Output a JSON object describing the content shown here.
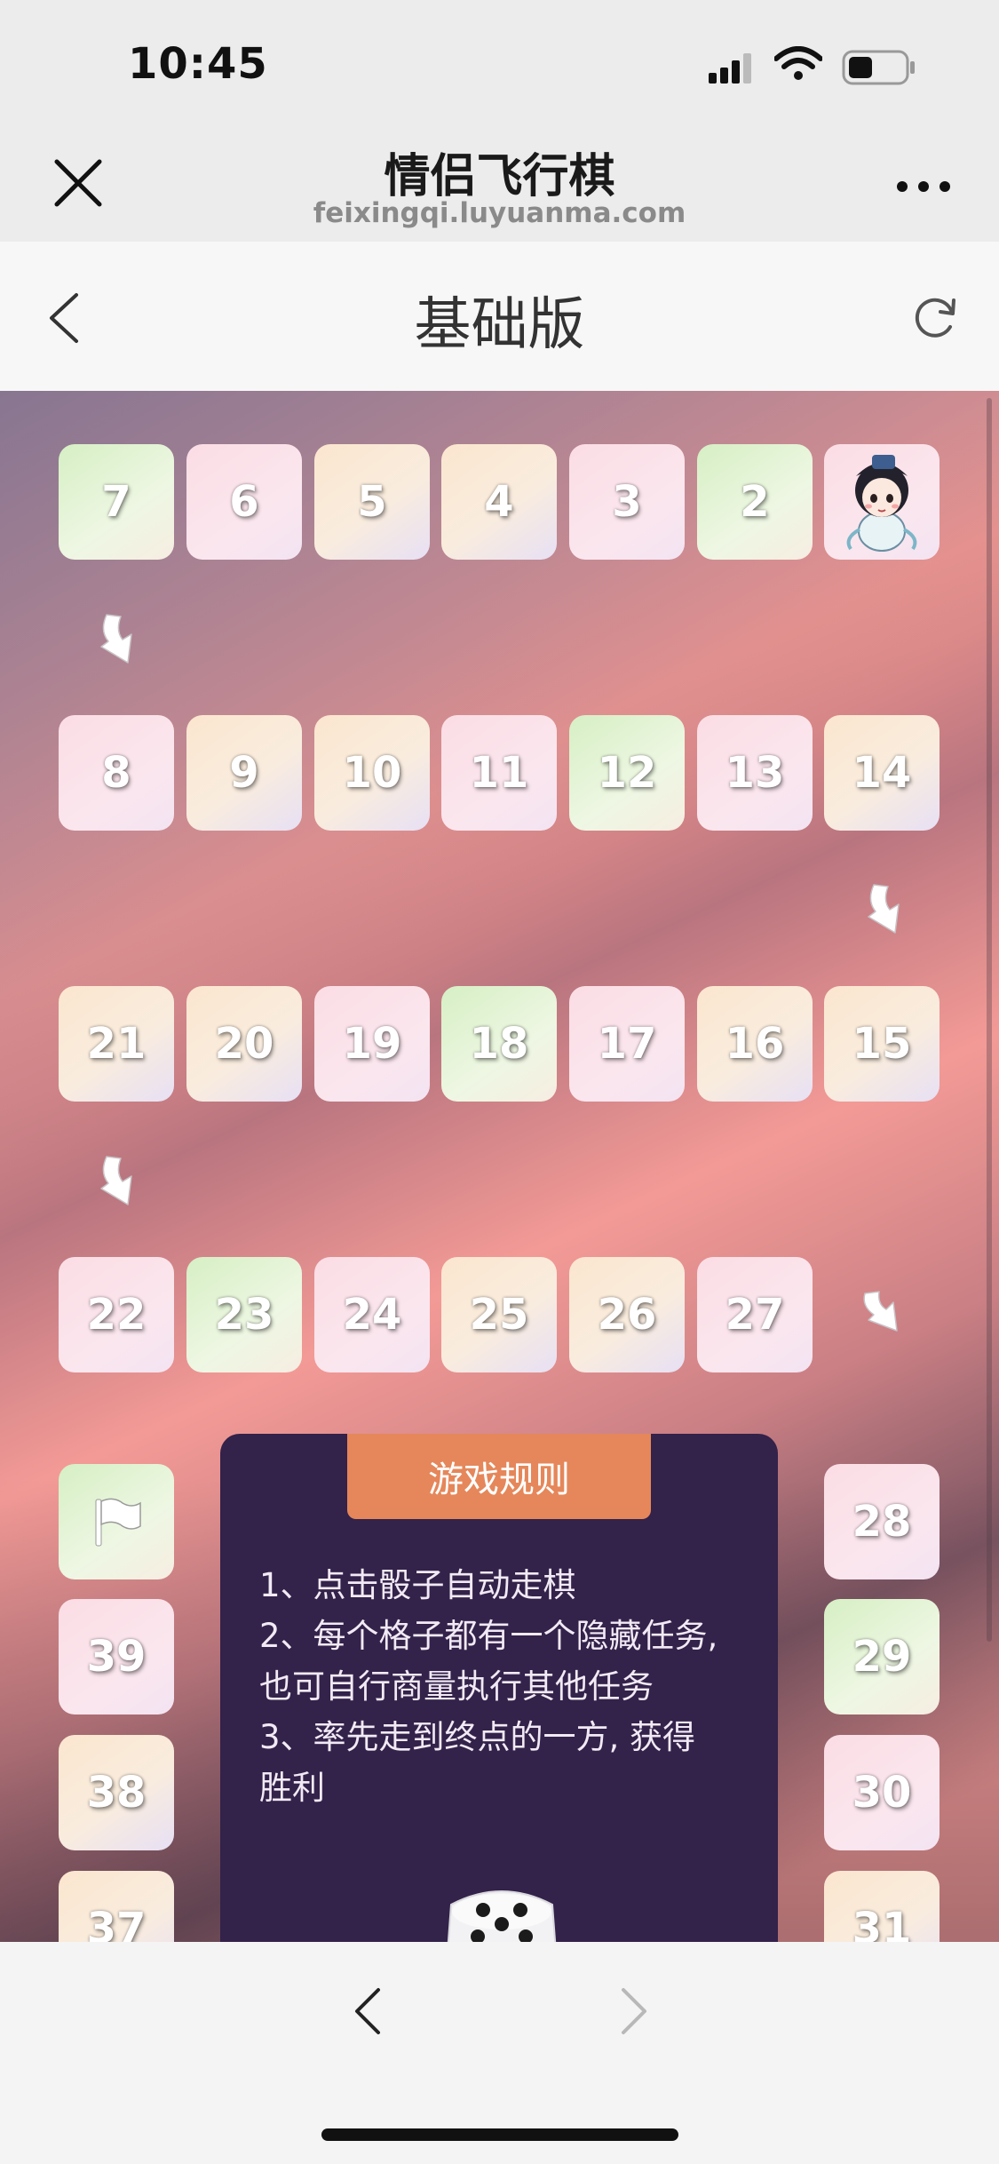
{
  "status_bar": {
    "time": "10:45"
  },
  "nav": {
    "title": "情侣飞行棋",
    "url": "feixingqi.luyuanma.com"
  },
  "page": {
    "title": "基础版"
  },
  "board": {
    "tiles": [
      {
        "label": "7",
        "color": "green"
      },
      {
        "label": "6",
        "color": "pink"
      },
      {
        "label": "5",
        "color": "peach"
      },
      {
        "label": "4",
        "color": "peach"
      },
      {
        "label": "3",
        "color": "pink"
      },
      {
        "label": "2",
        "color": "green"
      },
      {
        "label": "",
        "color": "pink",
        "content": "player-avatar"
      },
      {
        "label": "8",
        "color": "pink"
      },
      {
        "label": "9",
        "color": "peach"
      },
      {
        "label": "10",
        "color": "peach"
      },
      {
        "label": "11",
        "color": "pink"
      },
      {
        "label": "12",
        "color": "green"
      },
      {
        "label": "13",
        "color": "pink"
      },
      {
        "label": "14",
        "color": "peach"
      },
      {
        "label": "21",
        "color": "peach"
      },
      {
        "label": "20",
        "color": "peach"
      },
      {
        "label": "19",
        "color": "pink"
      },
      {
        "label": "18",
        "color": "green"
      },
      {
        "label": "17",
        "color": "pink"
      },
      {
        "label": "16",
        "color": "peach"
      },
      {
        "label": "15",
        "color": "peach"
      },
      {
        "label": "22",
        "color": "pink"
      },
      {
        "label": "23",
        "color": "green"
      },
      {
        "label": "24",
        "color": "pink"
      },
      {
        "label": "25",
        "color": "peach"
      },
      {
        "label": "26",
        "color": "peach"
      },
      {
        "label": "27",
        "color": "pink"
      },
      {
        "label": "",
        "color": "green",
        "content": "flag-icon"
      },
      {
        "label": "39",
        "color": "pink"
      },
      {
        "label": "38",
        "color": "peach"
      },
      {
        "label": "37",
        "color": "peach"
      },
      {
        "label": "28",
        "color": "pink"
      },
      {
        "label": "29",
        "color": "green"
      },
      {
        "label": "30",
        "color": "pink"
      },
      {
        "label": "31",
        "color": "peach"
      }
    ]
  },
  "rules": {
    "title": "游戏规则",
    "lines": [
      "1、点击骰子自动走棋",
      "2、每个格子都有一个隐藏任务,",
      "也可自行商量执行其他任务",
      "3、率先走到终点的一方, 获得",
      "胜利"
    ]
  },
  "colors": {
    "rules_panel": "#33224a",
    "rules_tab": "#e5875a",
    "tile_green": "#d6efc4",
    "tile_pink": "#fbdde4",
    "tile_peach": "#fbe6cf"
  },
  "icons": [
    "close-icon",
    "more-icon",
    "back-icon",
    "refresh-icon",
    "arrow-down-right-icon",
    "flag-icon",
    "dice-icon",
    "toolbar-back-icon",
    "toolbar-forward-icon"
  ]
}
